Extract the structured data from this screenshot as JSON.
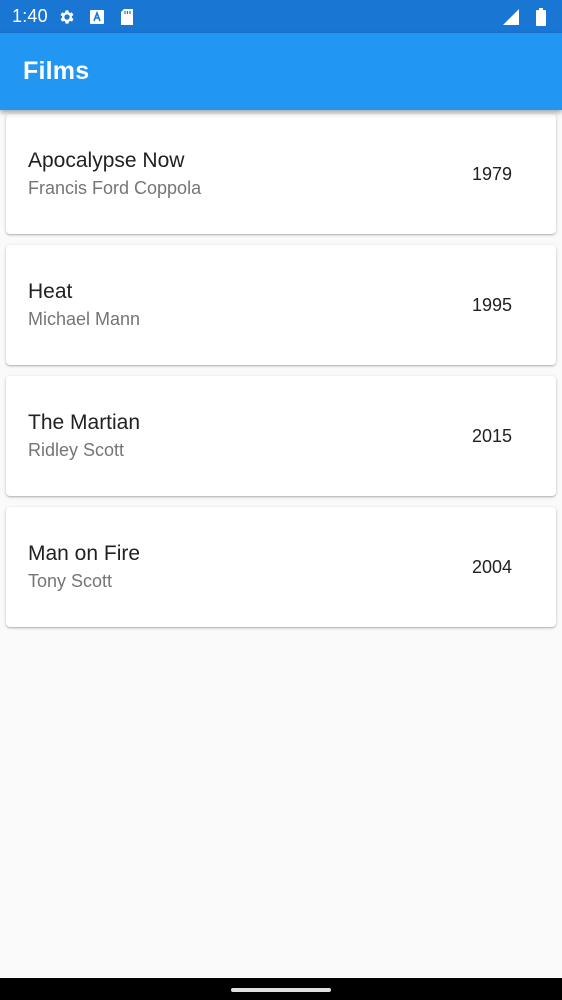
{
  "status_bar": {
    "time": "1:40",
    "left_icons": [
      "gear-icon",
      "a-box-icon",
      "sd-card-icon"
    ],
    "right_icons": [
      "signal-icon",
      "battery-icon"
    ]
  },
  "app_bar": {
    "title": "Films",
    "color": "#2196f3"
  },
  "films": [
    {
      "title": "Apocalypse Now",
      "director": "Francis Ford Coppola",
      "year": "1979"
    },
    {
      "title": "Heat",
      "director": "Michael Mann",
      "year": "1995"
    },
    {
      "title": "The Martian",
      "director": "Ridley Scott",
      "year": "2015"
    },
    {
      "title": "Man on Fire",
      "director": "Tony Scott",
      "year": "2004"
    }
  ]
}
